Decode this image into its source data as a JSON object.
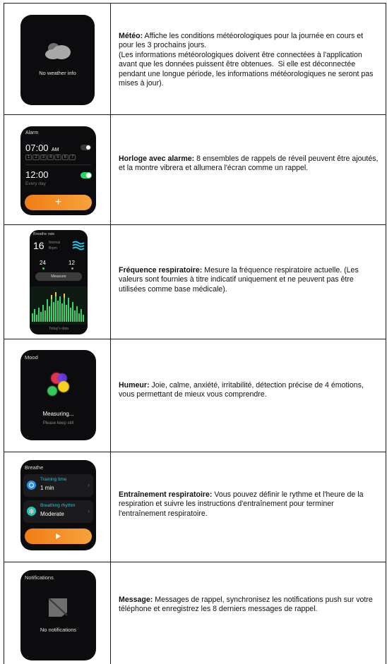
{
  "rows": [
    {
      "title": "Météo:",
      "text": " Affiche les conditions météorologiques pour la journée en cours et pour les 3 prochains jours.\n(Les informations météorologiques doivent être connectées à l'application avant que les données puissent être obtenues.  Si elle est déconnectée pendant une longue période, les informations météorologiques ne seront pas mises à jour).",
      "screen": {
        "label": "No weather info",
        "icon": "cloud-icon"
      }
    },
    {
      "title": "Horloge avec alarme:",
      "text": " 8 ensembles de rappels de réveil peuvent être ajoutés, et la montre vibrera et allumera l'écran comme un rappel.",
      "screen": {
        "header": "Alarm",
        "alarm1_time": "07:00",
        "alarm1_ampm": "AM",
        "days": [
          "1",
          "2",
          "3",
          "4",
          "5",
          "6",
          "7"
        ],
        "alarm2_time": "12:00",
        "alarm2_repeat": "Every day",
        "add_symbol": "+"
      }
    },
    {
      "title": "Fréquence respiratoire:",
      "text": " Mesure la fréquence respiratoire actuelle.  (Les valeurs sont fournies à titre indicatif uniquement et ne peuvent pas être utilisées comme base médicale).",
      "screen": {
        "header": "Breathe rate",
        "value": "16",
        "status": "Normal",
        "unit": "Brpm",
        "max": "24",
        "min": "12",
        "button": "Measure",
        "footer": "Today's data"
      }
    },
    {
      "title": "Humeur:",
      "text": " Joie, calme, anxiété, irritabilité, détection précise de 4 émotions, vous permettant de mieux vous comprendre.",
      "screen": {
        "header": "Mood",
        "status": "Measuring...",
        "hint": "Please keep still",
        "colors": [
          "#e8334a",
          "#6a3fe8",
          "#f6d21e",
          "#36c85a"
        ]
      }
    },
    {
      "title": "Entraînement respiratoire:",
      "text": " Vous pouvez définir le rythme et l'heure de la respiration et suivre les instructions d'entraînement pour terminer l'entraînement respiratoire.",
      "screen": {
        "header": "Breathe",
        "item1_label": "Training time",
        "item1_value": "1 min",
        "item2_label": "Breathing rhythm",
        "item2_value": "Moderate"
      }
    },
    {
      "title": "Message:",
      "text": " Messages de rappel, synchronisez les notifications push sur votre téléphone et enregistrez les 8 derniers messages de rappel.",
      "screen": {
        "header": "Notifications",
        "label": "No notifications"
      }
    }
  ],
  "colors": {
    "accent_orange": "#f5891e",
    "toggle_on": "#2bd46a",
    "cyan": "#28c3e0"
  }
}
